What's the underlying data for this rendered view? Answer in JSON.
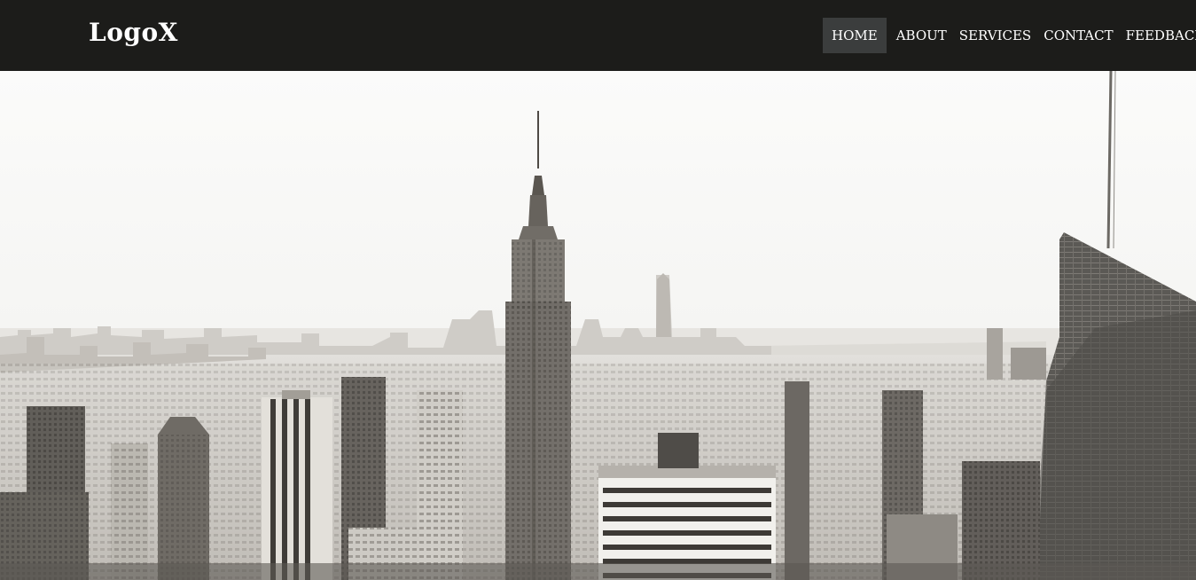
{
  "header": {
    "logo": "LogoX",
    "nav": [
      {
        "label": "HOME",
        "active": true
      },
      {
        "label": "ABOUT",
        "active": false
      },
      {
        "label": "SERVICES",
        "active": false
      },
      {
        "label": "CONTACT",
        "active": false
      },
      {
        "label": "FEEDBACK",
        "active": false
      }
    ]
  },
  "colors": {
    "navbar_bg": "#1c1c1a",
    "active_bg": "#3b3d3d",
    "text": "#ffffff"
  },
  "hero": {
    "image": "city-skyline-photo"
  }
}
